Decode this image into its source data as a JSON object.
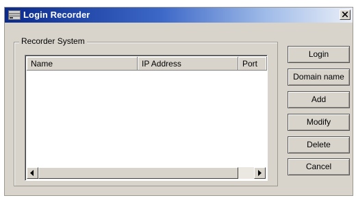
{
  "window": {
    "title": "Login Recorder",
    "close_glyph": "×"
  },
  "group": {
    "label": "Recorder System"
  },
  "table": {
    "columns": [
      "Name",
      "IP Address",
      "Port"
    ],
    "rows": []
  },
  "buttons": {
    "login": "Login",
    "domain_name": "Domain name",
    "add": "Add",
    "modify": "Modify",
    "delete": "Delete",
    "cancel": "Cancel"
  },
  "icons": {
    "app": "recorder-icon",
    "close": "close-icon",
    "scroll_left": "arrow-left-icon",
    "scroll_right": "arrow-right-icon"
  },
  "colors": {
    "titlebar_start": "#0a2a8c",
    "titlebar_end": "#e9eef8",
    "dialog_face": "#d8d4cc"
  }
}
